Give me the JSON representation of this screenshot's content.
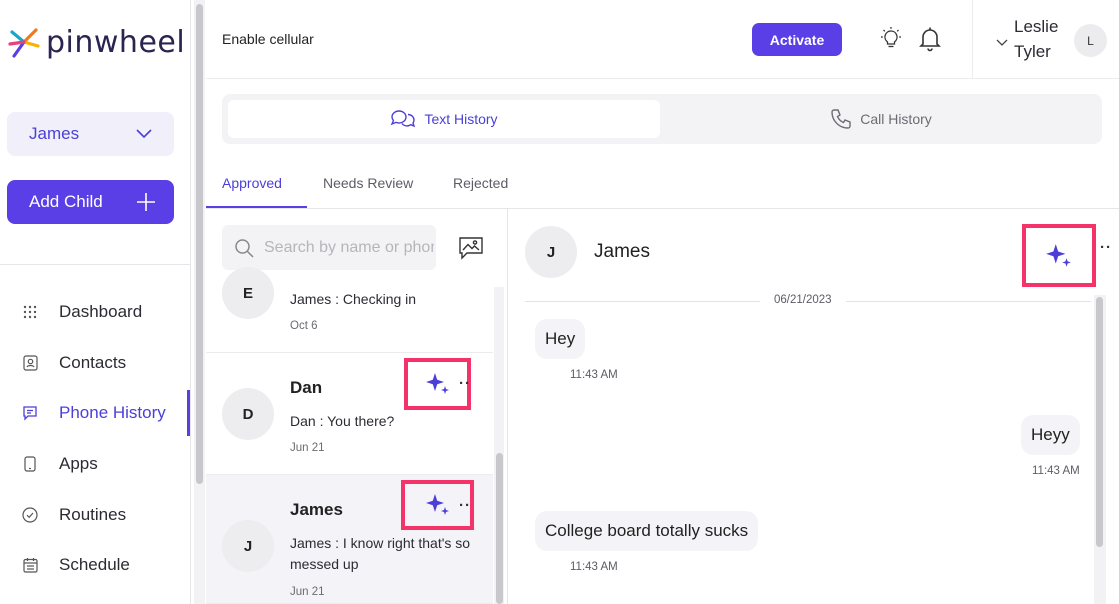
{
  "brand": {
    "name": "pinwheel"
  },
  "sidebar": {
    "child_select": "James",
    "add_child_label": "Add Child",
    "nav": [
      {
        "label": "Dashboard",
        "icon": "grid-icon"
      },
      {
        "label": "Contacts",
        "icon": "contact-card-icon"
      },
      {
        "label": "Phone History",
        "icon": "chat-bubble-icon",
        "active": true
      },
      {
        "label": "Apps",
        "icon": "phone-device-icon"
      },
      {
        "label": "Routines",
        "icon": "check-circle-icon"
      },
      {
        "label": "Schedule",
        "icon": "calendar-icon"
      }
    ]
  },
  "header": {
    "enable_text": "Enable cellular",
    "activate_label": "Activate",
    "user_first": "Leslie",
    "user_last": "Tyler",
    "user_initial": "L"
  },
  "history_tabs": {
    "text": "Text History",
    "call": "Call History"
  },
  "subtabs": {
    "approved": "Approved",
    "needs_review": "Needs Review",
    "rejected": "Rejected"
  },
  "search": {
    "placeholder": "Search by name or phone"
  },
  "conversations": [
    {
      "initial": "E",
      "message": "James : Checking in",
      "date": "Oct 6"
    },
    {
      "initial": "D",
      "name": "Dan",
      "message": "Dan : You there?",
      "date": "Jun 21"
    },
    {
      "initial": "J",
      "name": "James",
      "message": "James : I know right that's so messed up",
      "date": "Jun 21"
    }
  ],
  "chat": {
    "initial": "J",
    "name": "James",
    "date_separator": "06/21/2023",
    "messages": [
      {
        "text": "Hey",
        "time": "11:43 AM",
        "side": "left"
      },
      {
        "text": "Heyy",
        "time": "11:43 AM",
        "side": "right"
      },
      {
        "text": "College board totally sucks",
        "time": "11:43 AM",
        "side": "left"
      }
    ]
  },
  "colors": {
    "accent": "#5a3ee6",
    "highlight_box": "#f5336b",
    "sparkle": "#4b3fd8"
  }
}
